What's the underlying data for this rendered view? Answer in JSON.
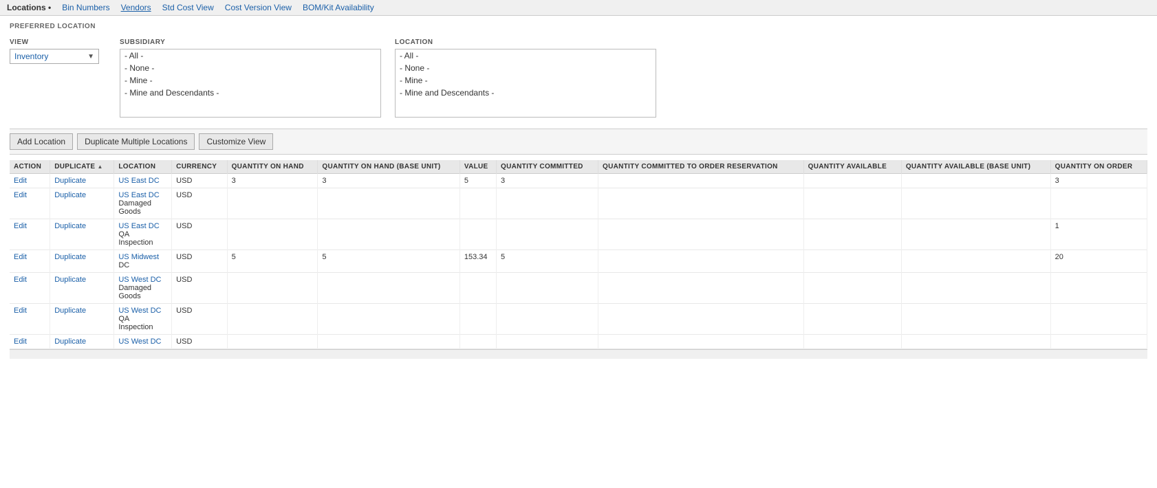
{
  "nav": {
    "items": [
      {
        "label": "Locations •",
        "active": true
      },
      {
        "label": "Bin Numbers",
        "active": false
      },
      {
        "label": "Vendors",
        "active": false
      },
      {
        "label": "Std Cost View",
        "active": false
      },
      {
        "label": "Cost Version View",
        "active": false
      },
      {
        "label": "BOM/Kit Availability",
        "active": false
      }
    ]
  },
  "preferred_location_label": "PREFERRED LOCATION",
  "view_label": "VIEW",
  "view_value": "Inventory",
  "subsidiary": {
    "label": "SUBSIDIARY",
    "items": [
      "- All -",
      "- None -",
      "- Mine -",
      "- Mine and Descendants -"
    ]
  },
  "location": {
    "label": "LOCATION",
    "items": [
      "- All -",
      "- None -",
      "- Mine -",
      "- Mine and Descendants -"
    ]
  },
  "toolbar": {
    "add_location": "Add Location",
    "duplicate_multiple": "Duplicate Multiple Locations",
    "customize_view": "Customize View"
  },
  "table": {
    "columns": [
      {
        "key": "action",
        "label": "ACTION"
      },
      {
        "key": "duplicate",
        "label": "DUPLICATE",
        "sort": "asc"
      },
      {
        "key": "location",
        "label": "LOCATION"
      },
      {
        "key": "currency",
        "label": "CURRENCY"
      },
      {
        "key": "qty_on_hand",
        "label": "QUANTITY ON HAND"
      },
      {
        "key": "qty_on_hand_base",
        "label": "QUANTITY ON HAND (BASE UNIT)"
      },
      {
        "key": "value",
        "label": "VALUE"
      },
      {
        "key": "qty_committed",
        "label": "QUANTITY COMMITTED"
      },
      {
        "key": "qty_committed_order",
        "label": "QUANTITY COMMITTED TO ORDER RESERVATION"
      },
      {
        "key": "qty_available",
        "label": "QUANTITY AVAILABLE"
      },
      {
        "key": "qty_available_base",
        "label": "QUANTITY AVAILABLE (BASE UNIT)"
      },
      {
        "key": "qty_on_order",
        "label": "QUANTITY ON ORDER"
      }
    ],
    "rows": [
      {
        "action": "Edit",
        "duplicate": "Duplicate",
        "location": "US East DC",
        "currency": "USD",
        "qty_on_hand": "3",
        "qty_on_hand_base": "3",
        "value": "5",
        "qty_committed": "3",
        "qty_committed_order": "",
        "qty_available": "",
        "qty_available_base": "",
        "qty_on_order": "3"
      },
      {
        "action": "Edit",
        "duplicate": "Duplicate",
        "location": "US East DC\nDamaged\nGoods",
        "currency": "USD",
        "qty_on_hand": "",
        "qty_on_hand_base": "",
        "value": "",
        "qty_committed": "",
        "qty_committed_order": "",
        "qty_available": "",
        "qty_available_base": "",
        "qty_on_order": ""
      },
      {
        "action": "Edit",
        "duplicate": "Duplicate",
        "location": "US East DC\nQA\nInspection",
        "currency": "USD",
        "qty_on_hand": "",
        "qty_on_hand_base": "",
        "value": "",
        "qty_committed": "",
        "qty_committed_order": "",
        "qty_available": "",
        "qty_available_base": "",
        "qty_on_order": "1"
      },
      {
        "action": "Edit",
        "duplicate": "Duplicate",
        "location": "US Midwest\nDC",
        "currency": "USD",
        "qty_on_hand": "5",
        "qty_on_hand_base": "5",
        "value": "153.34",
        "qty_committed": "5",
        "qty_committed_order": "",
        "qty_available": "",
        "qty_available_base": "",
        "qty_on_order": "20"
      },
      {
        "action": "Edit",
        "duplicate": "Duplicate",
        "location": "US West DC\nDamaged\nGoods",
        "currency": "USD",
        "qty_on_hand": "",
        "qty_on_hand_base": "",
        "value": "",
        "qty_committed": "",
        "qty_committed_order": "",
        "qty_available": "",
        "qty_available_base": "",
        "qty_on_order": ""
      },
      {
        "action": "Edit",
        "duplicate": "Duplicate",
        "location": "US West DC\nQA\nInspection",
        "currency": "USD",
        "qty_on_hand": "",
        "qty_on_hand_base": "",
        "value": "",
        "qty_committed": "",
        "qty_committed_order": "",
        "qty_available": "",
        "qty_available_base": "",
        "qty_on_order": ""
      },
      {
        "action": "Edit",
        "duplicate": "Duplicate",
        "location": "US West DC",
        "currency": "USD",
        "qty_on_hand": "",
        "qty_on_hand_base": "",
        "value": "",
        "qty_committed": "",
        "qty_committed_order": "",
        "qty_available": "",
        "qty_available_base": "",
        "qty_on_order": ""
      }
    ]
  }
}
